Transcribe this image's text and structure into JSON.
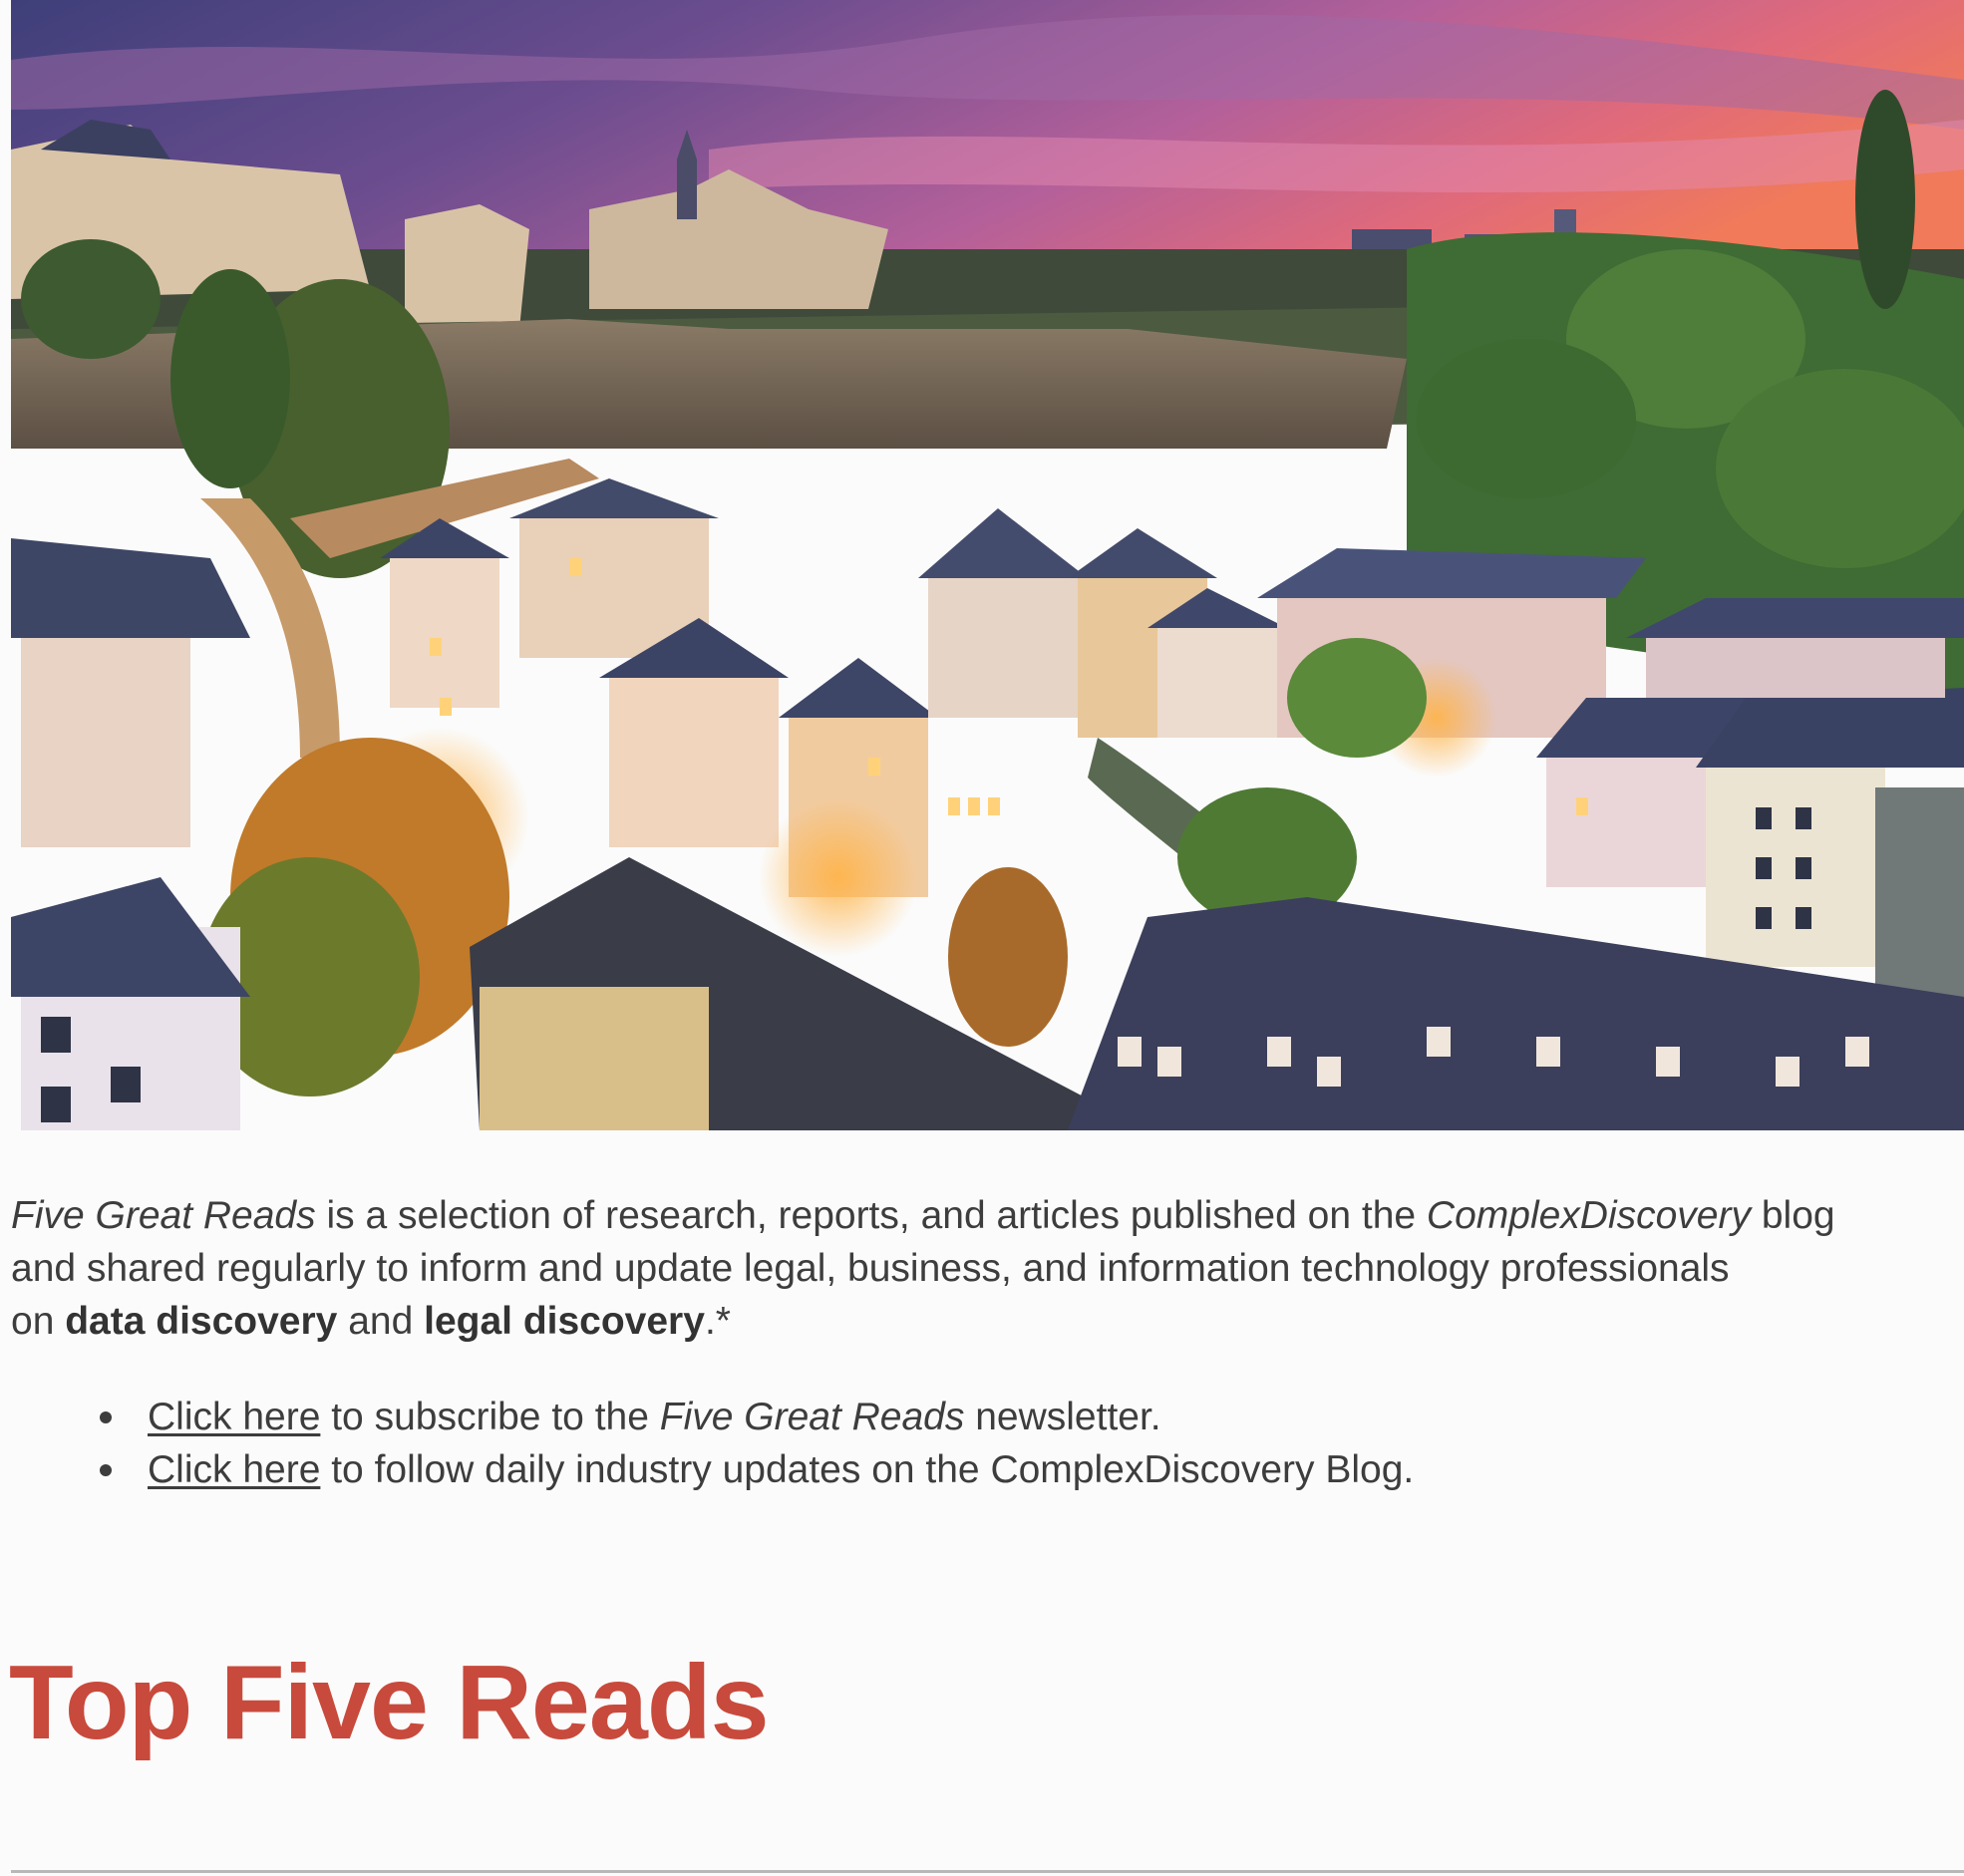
{
  "hero": {
    "image_semantic": "luxembourg-old-town-sunset-photo"
  },
  "intro": {
    "part1_italic": "Five Great Reads",
    "part2": " is a selection of research, reports, and articles published on the ",
    "part3_italic": "ComplexDiscovery",
    "part4": " blog",
    "line2": "and shared regularly to inform and update legal, business, and information technology professionals",
    "line3_prefix": "on ",
    "line3_bold1": "data discovery",
    "line3_mid": " and ",
    "line3_bold2": "legal discovery",
    "line3_suffix": ".*"
  },
  "links": {
    "items": [
      {
        "link_text": "Click here",
        "text_before_italic": " to subscribe to the ",
        "italic": "Five Great Reads",
        "text_after": " newsletter."
      },
      {
        "link_text": "Click here",
        "text_after": " to follow daily industry updates on the ComplexDiscovery Blog."
      }
    ]
  },
  "heading": {
    "title": "Top Five Reads"
  },
  "colors": {
    "heading": "#c84a3c",
    "body_text": "#3d3d3d",
    "background": "#fbfbfb",
    "divider": "#b8b8b8"
  }
}
